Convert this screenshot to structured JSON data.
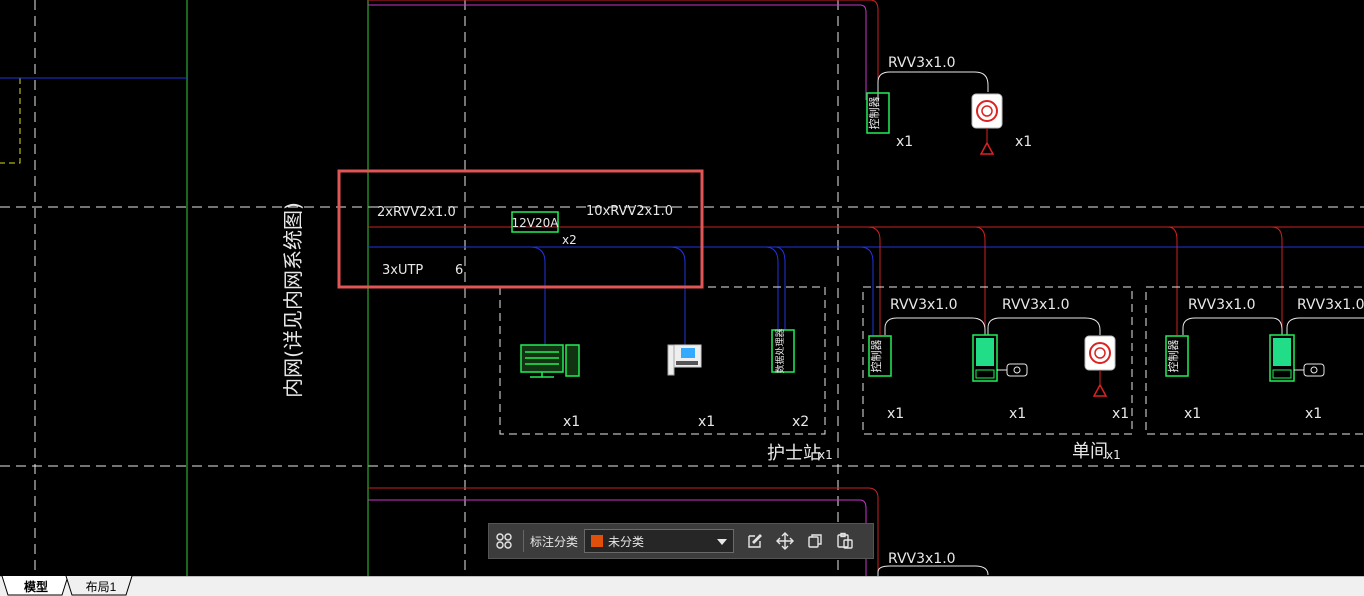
{
  "drawing": {
    "system_title": "内网(详见内网系统图)",
    "cable_2rvv": "2xRVV2x1.0",
    "power_unit": "12V20A",
    "power_qty": "x2",
    "cable_10rvv": "10xRVV2x1.0",
    "cable_utp": "3xUTP",
    "utp_count": "6",
    "rvv3_label": "RVV3x1.0",
    "controller_label": "控制器",
    "data_processor_label": "数据处理器",
    "qty_x1": "x1",
    "qty_x2": "x2",
    "room_nurse_station": "护士站",
    "room_single": "单间",
    "room_suffix_x1": "x1"
  },
  "toolbar": {
    "label": "标注分类",
    "selected_category": "未分类",
    "swatch_color": "#e0500a",
    "icons": [
      "grid-icon",
      "edit-icon",
      "move-icon",
      "copy-icon",
      "paste-icon"
    ]
  },
  "tabs": {
    "model": "模型",
    "layout1": "布局1"
  },
  "colors": {
    "background": "#000000",
    "highlight_box": "#e05555",
    "wire_red": "#cc2222",
    "wire_blue": "#2233dd",
    "wire_magenta": "#cc33cc",
    "device_green": "#22ee55"
  }
}
